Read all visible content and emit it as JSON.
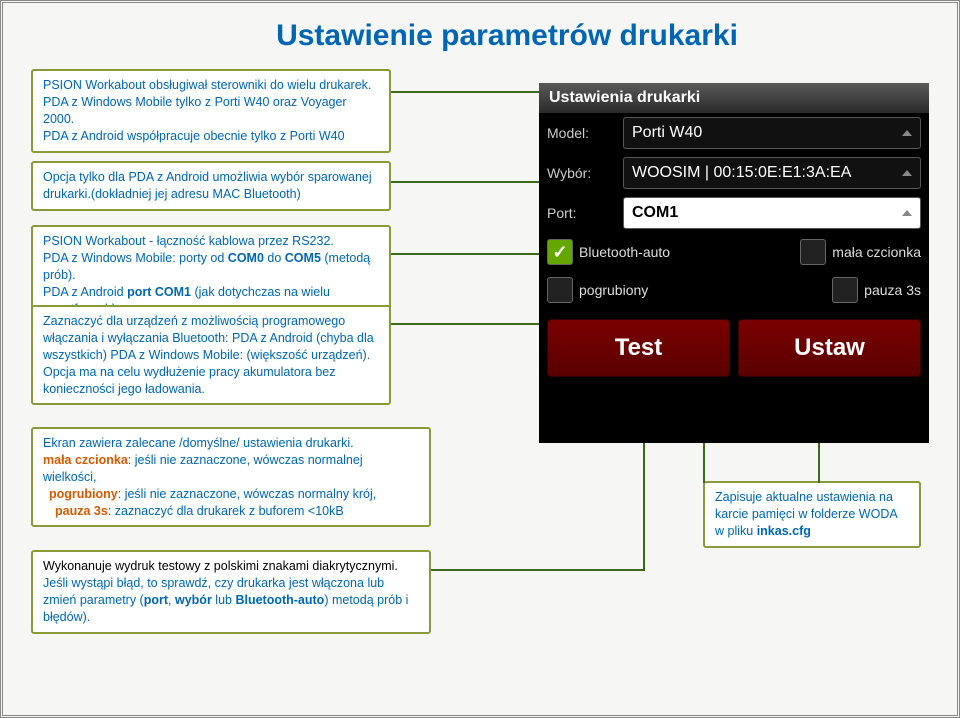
{
  "title": "Ustawienie parametrów drukarki",
  "notes": {
    "n1a": "PSION Workabout obsługiwał sterowniki do wielu drukarek.",
    "n1b": "PDA z Windows Mobile tylko z Porti W40 oraz Voyager 2000.",
    "n1c": "PDA z Android współpracuje obecnie tylko z Porti W40",
    "n2a": "Opcja tylko dla PDA z Android umożliwia wybór sparowanej drukarki.(dokładniej jej adresu MAC Bluetooth)",
    "n3a": "PSION Workabout - łączność kablowa przez RS232.",
    "n3b_pre": "PDA z Windows Mobile: porty od ",
    "n3b_b1": "COM0",
    "n3b_mid": " do ",
    "n3b_b2": "COM5",
    "n3b_post": " (metodą prób).",
    "n3c_pre": "PDA z Android ",
    "n3c_b": "port COM1",
    "n3c_post": " (jak dotychczas na wielu smartfonach).",
    "n4a": "Zaznaczyć dla urządzeń z możliwością programowego włączania i wyłączania Bluetooth: PDA z Android (chyba dla wszystkich) PDA z Windows Mobile: (większość urządzeń). Opcja ma na celu wydłużenie pracy akumulatora bez konieczności jego ładowania.",
    "n5a": "Ekran zawiera zalecane /domyślne/ ustawienia drukarki.",
    "n5b_o": "mała czcionka",
    "n5b": ": jeśli nie zaznaczone, wówczas normalnej wielkości,",
    "n5c_o": "pogrubiony",
    "n5c": ": jeśli nie zaznaczone, wówczas normalny krój,",
    "n5d_o": "pauza 3s",
    "n5d": ": zaznaczyć dla drukarek z buforem <10kB",
    "n6a": "Wykonanuje wydruk testowy z polskimi znakami diakrytycznymi.",
    "n6b_pre": "Jeśli wystąpi błąd, to sprawdź, czy drukarka jest włączona lub zmień parametry (",
    "n6b_b1": "port",
    "n6b_c1": ", ",
    "n6b_b2": "wybór",
    "n6b_c2": " lub ",
    "n6b_b3": "Bluetooth-auto",
    "n6b_post": ") metodą prób i błędów).",
    "n7a": "Zapisuje aktualne ustawienia na karcie pamięci w folderze WODA w pliku ",
    "n7b": "inkas.cfg"
  },
  "phone": {
    "header": "Ustawienia drukarki",
    "model_label": "Model:",
    "model_value": "Porti W40",
    "choice_label": "Wybór:",
    "choice_value": "WOOSIM | 00:15:0E:E1:3A:EA",
    "port_label": "Port:",
    "port_value": "COM1",
    "chk_bt": "Bluetooth-auto",
    "chk_font": "mała czcionka",
    "chk_bold": "pogrubiony",
    "chk_pause": "pauza 3s",
    "btn_test": "Test",
    "btn_set": "Ustaw"
  }
}
